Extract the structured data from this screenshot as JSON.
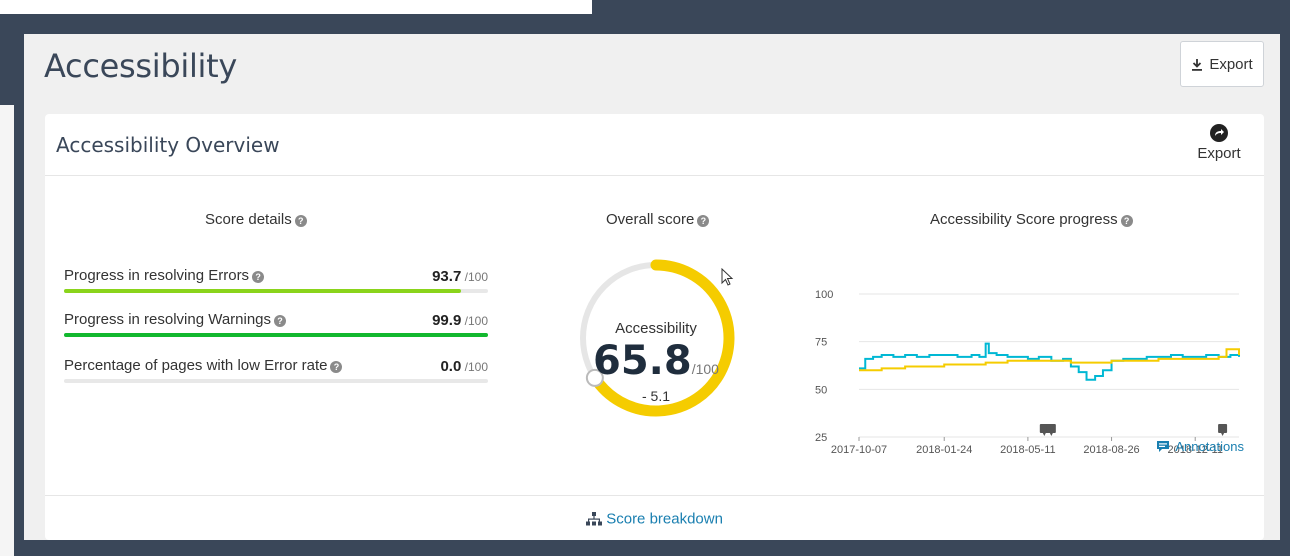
{
  "page": {
    "title": "Accessibility",
    "export_label": "Export"
  },
  "overview": {
    "title": "Accessibility Overview",
    "export_label": "Export",
    "score_details": {
      "title": "Score details",
      "items": [
        {
          "label": "Progress in resolving Errors",
          "value": "93.7",
          "max": "/100",
          "fraction": 0.937,
          "color": "#8ad41b"
        },
        {
          "label": "Progress in resolving Warnings",
          "value": "99.9",
          "max": "/100",
          "fraction": 0.999,
          "color": "#12b82e"
        },
        {
          "label": "Percentage of pages with low Error rate",
          "value": "0.0",
          "max": "/100",
          "fraction": 0.0,
          "color": "#12b82e"
        }
      ]
    },
    "overall": {
      "title": "Overall score",
      "label": "Accessibility",
      "score": "65.8",
      "max": "/100",
      "delta": "- 5.1",
      "fraction": 0.658,
      "arc_color": "#f5cc00",
      "track_color": "#e6e6e6"
    },
    "progress": {
      "title": "Accessibility Score progress",
      "annotations_label": "Annotations"
    },
    "footer": {
      "breakdown_label": "Score breakdown"
    }
  },
  "colors": {
    "accent_blue": "#1a7fb0",
    "header_navy": "#3a4759"
  },
  "chart_data": {
    "type": "line",
    "x_tick_labels": [
      "2017-10-07",
      "2018-01-24",
      "2018-05-11",
      "2018-08-26",
      "2018-12-11"
    ],
    "y_tick_labels": [
      "25",
      "50",
      "75",
      "100"
    ],
    "ylim": [
      25,
      100
    ],
    "grid": true,
    "series": [
      {
        "color": "#00b8d4",
        "x": [
          "2017-10-07",
          "2017-10-15",
          "2017-10-25",
          "2017-11-05",
          "2017-11-20",
          "2017-12-05",
          "2017-12-20",
          "2018-01-05",
          "2018-01-24",
          "2018-02-10",
          "2018-02-28",
          "2018-03-10",
          "2018-03-18",
          "2018-03-22",
          "2018-04-01",
          "2018-04-15",
          "2018-05-01",
          "2018-05-11",
          "2018-05-25",
          "2018-06-10",
          "2018-06-25",
          "2018-07-05",
          "2018-07-15",
          "2018-07-25",
          "2018-08-05",
          "2018-08-15",
          "2018-08-26",
          "2018-09-10",
          "2018-09-25",
          "2018-10-10",
          "2018-10-25",
          "2018-11-10",
          "2018-11-25",
          "2018-12-11",
          "2018-12-25",
          "2019-01-10",
          "2019-01-25",
          "2019-02-05"
        ],
        "y": [
          61,
          66,
          67,
          68,
          67,
          68,
          67,
          68,
          68,
          67,
          68,
          67,
          74,
          69,
          68,
          67,
          67,
          66,
          67,
          65,
          66,
          62,
          59,
          55,
          57,
          60,
          65,
          66,
          66,
          67,
          67,
          68,
          67,
          67,
          68,
          67,
          68,
          67
        ]
      },
      {
        "color": "#f5cc00",
        "x": [
          "2017-10-07",
          "2017-10-15",
          "2017-11-05",
          "2017-12-05",
          "2018-01-05",
          "2018-01-24",
          "2018-02-28",
          "2018-03-18",
          "2018-04-15",
          "2018-05-11",
          "2018-06-10",
          "2018-06-25",
          "2018-07-05",
          "2018-08-05",
          "2018-08-26",
          "2018-09-25",
          "2018-10-25",
          "2018-11-25",
          "2018-12-11",
          "2019-01-10",
          "2019-01-20",
          "2019-02-05"
        ],
        "y": [
          60,
          60,
          61,
          62,
          62,
          63,
          63,
          64,
          65,
          65,
          65,
          65,
          64,
          64,
          65,
          65,
          66,
          66,
          66,
          67,
          71,
          68
        ]
      }
    ],
    "annotation_markers": [
      {
        "x": "2018-06-01"
      },
      {
        "x": "2018-06-10"
      },
      {
        "x": "2019-01-15"
      }
    ]
  }
}
